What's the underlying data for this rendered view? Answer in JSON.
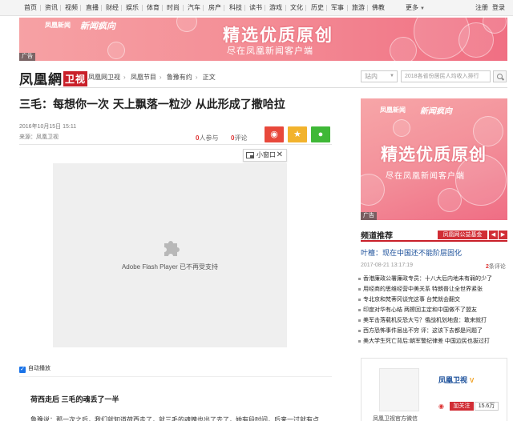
{
  "topnav": {
    "items": [
      "首页",
      "资讯",
      "视频",
      "直播",
      "财经",
      "娱乐",
      "体育",
      "时尚",
      "汽车",
      "房产",
      "科技",
      "读书",
      "游戏",
      "文化",
      "历史",
      "军事",
      "旅游",
      "佛教"
    ],
    "more": "更多",
    "register": "注册",
    "login": "登录"
  },
  "banner": {
    "brand": "凤凰新闻",
    "brand_en": "IFENG NEWS",
    "brand2": "新闻疯向",
    "headline": "精选优质原创",
    "sub": "尽在凤凰新闻客户端",
    "ad_label": "广告"
  },
  "header": {
    "logo": "凤凰網",
    "logo_tag": "卫视",
    "breadcrumb": [
      "凤凰网卫视",
      "凤凰节目",
      "鲁豫有约",
      "正文"
    ],
    "search_scope": "站内",
    "search_placeholder": "2018各省份居民人均收入排行"
  },
  "article": {
    "title": "三毛：每想你一次 天上飘落一粒沙 从此形成了撒哈拉",
    "date": "2016年10月15日 15:11",
    "source": "来源：凤凰卫视",
    "participants_count": "0",
    "participants_label": "人参与",
    "comments_count": "0",
    "comments_label": "评论",
    "mini_window_label": "小窗口",
    "plugin_message": "Adobe Flash Player 已不再受支持",
    "autoplay_label": "自动播放",
    "subhead": "荷西走后 三毛的魂丢了一半",
    "paragraph": "鲁豫说：那一次之后，我们就知道荷西走了，就三毛的魂魄也出了去了，她有段时间，后来一过就有点"
  },
  "sidebar": {
    "ad": {
      "brand": "凤凰新闻",
      "brand2": "新闻疯向",
      "headline": "精选优质原创",
      "sub": "尽在凤凰新闻客户端",
      "ad_label": "广告"
    },
    "channel_title": "频道推荐",
    "channel_tag": "凤凰网公益基金",
    "lead_title": "叶檀：现在中国还不能阶层固化",
    "lead_time": "2017-08-21 13:17:19",
    "lead_comments_count": "2",
    "lead_comments_label": "条评论",
    "news": [
      "香港廉政公署廉政专员：十八大后内地未有弱的少了",
      "用经商的思维经营中美关系 特朗普让全世界紧张",
      "专北京和梵蒂冈谈完这事 台梵就会翻交",
      "印度对华有心结 两擦回主定和中国做不了盟友",
      "美军击落载机反恐大亏？俄战机划地盘：敢来就打",
      "西方恐怖事件层出不穷 评：这该下去都是问题了",
      "美大学生死亡背后:朝军警纪律差 中国边民也拔过打"
    ],
    "account_name": "凤凰卫视",
    "account_badge": "V",
    "account_caption": "凤凰卫视官方微信",
    "follow_label": "加关注",
    "fans_count": "15.6万"
  }
}
